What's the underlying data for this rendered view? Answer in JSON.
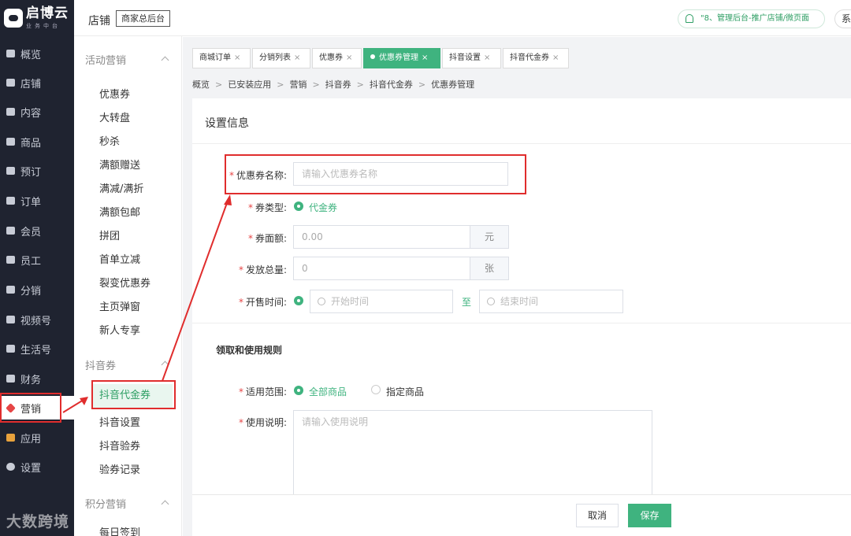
{
  "brand": {
    "name": "启博云",
    "sub": "业务中台"
  },
  "nav": [
    {
      "label": "概览",
      "icon": "monitor-icon"
    },
    {
      "label": "店铺",
      "icon": "home-icon"
    },
    {
      "label": "内容",
      "icon": "layers-icon"
    },
    {
      "label": "商品",
      "icon": "box-icon"
    },
    {
      "label": "预订",
      "icon": "heart-icon"
    },
    {
      "label": "订单",
      "icon": "document-icon"
    },
    {
      "label": "会员",
      "icon": "user-icon"
    },
    {
      "label": "员工",
      "icon": "staff-icon"
    },
    {
      "label": "分销",
      "icon": "hierarchy-icon"
    },
    {
      "label": "视频号",
      "icon": "infinity-icon"
    },
    {
      "label": "生活号",
      "icon": "bookmark-icon"
    },
    {
      "label": "财务",
      "icon": "wallet-icon"
    },
    {
      "label": "营销",
      "icon": "tag-icon",
      "active": true
    },
    {
      "label": "应用",
      "icon": "grid-icon"
    },
    {
      "label": "设置",
      "icon": "gear-icon"
    }
  ],
  "subnav": {
    "groups": [
      {
        "title": "活动营销",
        "items": [
          "优惠券",
          "大转盘",
          "秒杀",
          "满额赠送",
          "满减/满折",
          "满额包邮",
          "拼团",
          "首单立减",
          "裂变优惠券",
          "主页弹窗",
          "新人专享"
        ]
      },
      {
        "title": "抖音券",
        "items": [
          "抖音代金券",
          "抖音设置",
          "抖音验券",
          "验券记录"
        ]
      },
      {
        "title": "积分营销",
        "items": [
          "每日签到"
        ]
      }
    ],
    "active_item": "抖音代金券"
  },
  "topbar": {
    "shop_label": "店铺",
    "shop_button": "商家总后台",
    "notice": "\"8、管理后台-推广店铺/微页面",
    "system_button": "系"
  },
  "tabs": [
    {
      "label": "商城订单",
      "close": "×"
    },
    {
      "label": "分销列表",
      "close": "×"
    },
    {
      "label": "优惠券",
      "close": "×"
    },
    {
      "label": "优惠券管理",
      "close": "×",
      "active": true
    },
    {
      "label": "抖音设置",
      "close": "×"
    },
    {
      "label": "抖音代金券",
      "close": "×"
    }
  ],
  "breadcrumb": [
    "概览",
    "已安装应用",
    "营销",
    "抖音券",
    "抖音代金券",
    "优惠券管理"
  ],
  "breadcrumb_sep": ">",
  "form": {
    "section_title": "设置信息",
    "name": {
      "label": "优惠券名称:",
      "placeholder": "请输入优惠券名称"
    },
    "type": {
      "label": "券类型:",
      "option": "代金券"
    },
    "face_value": {
      "label": "券面额:",
      "value": "0.00",
      "unit": "元"
    },
    "total": {
      "label": "发放总量:",
      "value": "0",
      "unit": "张"
    },
    "sale_time": {
      "label": "开售时间:",
      "start_placeholder": "开始时间",
      "to": "至",
      "end_placeholder": "结束时间"
    },
    "rules_title": "领取和使用规则",
    "scope": {
      "label": "适用范围:",
      "options": [
        "全部商品",
        "指定商品"
      ],
      "selected": "全部商品"
    },
    "usage": {
      "label": "使用说明:",
      "placeholder": "请输入使用说明"
    },
    "required_mark": "*"
  },
  "footer": {
    "cancel": "取消",
    "save": "保存"
  },
  "watermark": "大数跨境",
  "colors": {
    "accent": "#3fb37f",
    "sidebar_bg": "#1f2330",
    "annotation": "#e02d2d",
    "required": "#e64545"
  }
}
